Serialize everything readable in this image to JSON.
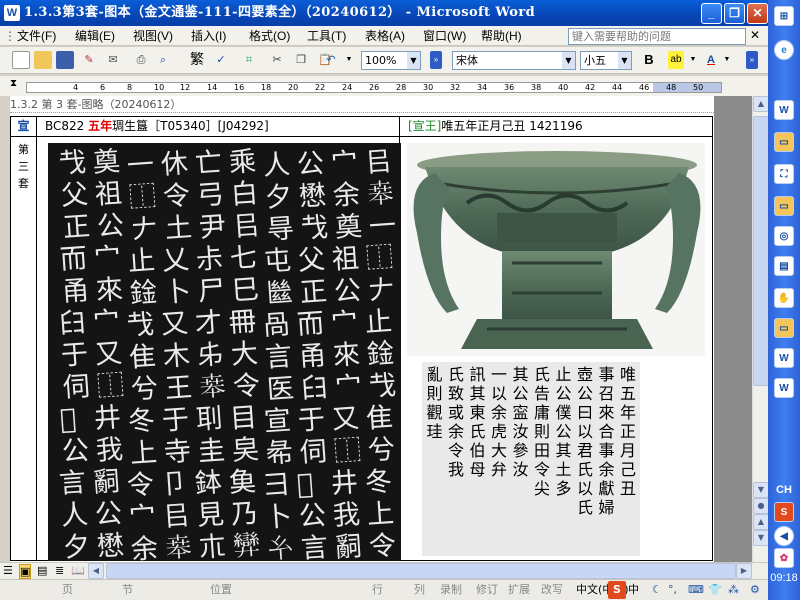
{
  "window": {
    "title": "1.3.3第3套-图本（金文通鉴-111-四要素全）（20240612） - Microsoft Word",
    "app_icon": "word-icon"
  },
  "menu": [
    "文件(F)",
    "编辑(E)",
    "视图(V)",
    "插入(I)",
    "格式(O)",
    "工具(T)",
    "表格(A)",
    "窗口(W)",
    "帮助(H)"
  ],
  "help_placeholder": "键入需要帮助的问题",
  "toolbar": {
    "trad_label": "繁",
    "zoom": "100%",
    "font": "宋体",
    "size": "小五",
    "bold": "B"
  },
  "ruler_numbers": [
    "4",
    "6",
    "8",
    "10",
    "12",
    "14",
    "16",
    "18",
    "20",
    "22",
    "24",
    "26",
    "28",
    "30",
    "32",
    "34",
    "36",
    "38",
    "40",
    "42",
    "44",
    "46",
    "48",
    "50"
  ],
  "document": {
    "header": "1.3.2 第 3 套-图略（20240612）",
    "dynasty": "宣",
    "set_label": [
      "第",
      "三",
      "套"
    ],
    "left_heading": {
      "prefix": "BC822 ",
      "red": "五年",
      "rest": "琱生簋［T05340］[J04292]"
    },
    "right_heading": {
      "bracket": "[宣王]",
      "rest": "唯五年正月己丑 1421196"
    },
    "rubbing_glyphs": [
      "㠯",
      "𠦪",
      "一",
      "⿰",
      "𠂇",
      "止",
      "鍂",
      "𢦏",
      "隹",
      "兮",
      "冬",
      "上",
      "令",
      "宀",
      "余",
      "奠",
      "祖",
      "公",
      "宀",
      "來",
      "宀",
      "又",
      "⿰",
      "井",
      "我",
      "𤔲",
      "公",
      "懋",
      "𢦏",
      "父",
      "正",
      "而",
      "甬",
      "𦥑",
      "于",
      "伺",
      "𠑇",
      "公",
      "言",
      "人",
      "夕",
      "㝵",
      "屯",
      "㡭",
      "咼",
      "言",
      "医",
      "宣",
      "㣇",
      "彐",
      "卜",
      "𢆯",
      "乘",
      "白",
      "㠯",
      "七",
      "巳",
      "𠕋",
      "大",
      "令",
      "目",
      "㚖",
      "𩵋",
      "乃",
      "𢍶",
      "亡",
      "弓",
      "尹",
      "尗",
      "尸",
      "才",
      "𠂔",
      "𠦪",
      "刵",
      "圭",
      "鉢",
      "見",
      "𣎳",
      "休",
      "令",
      "土",
      "乂",
      "卜",
      "又",
      "木",
      "王",
      "于",
      "寺",
      "卩"
    ],
    "transcript_columns": [
      "唯五年正月己丑",
      "事召來合事余獻婦",
      "壺公曰以君氏以氏",
      "止公僕公其土多",
      "氏告庸則田令尖",
      "其公寍汝參汝",
      "一以余虎大弁",
      "訊其東氏伯母",
      "氏致或余令我",
      "亂則觀珪"
    ]
  },
  "status": {
    "page": "页",
    "section": "节",
    "position": "位置",
    "line": "行",
    "column": "列",
    "rec": "录制",
    "trk": "修订",
    "ext": "扩展",
    "ovr": "改写",
    "lang": "中文(中国)",
    "ime": "中"
  },
  "taskbar": {
    "lang": "CH",
    "time": "09:18"
  }
}
